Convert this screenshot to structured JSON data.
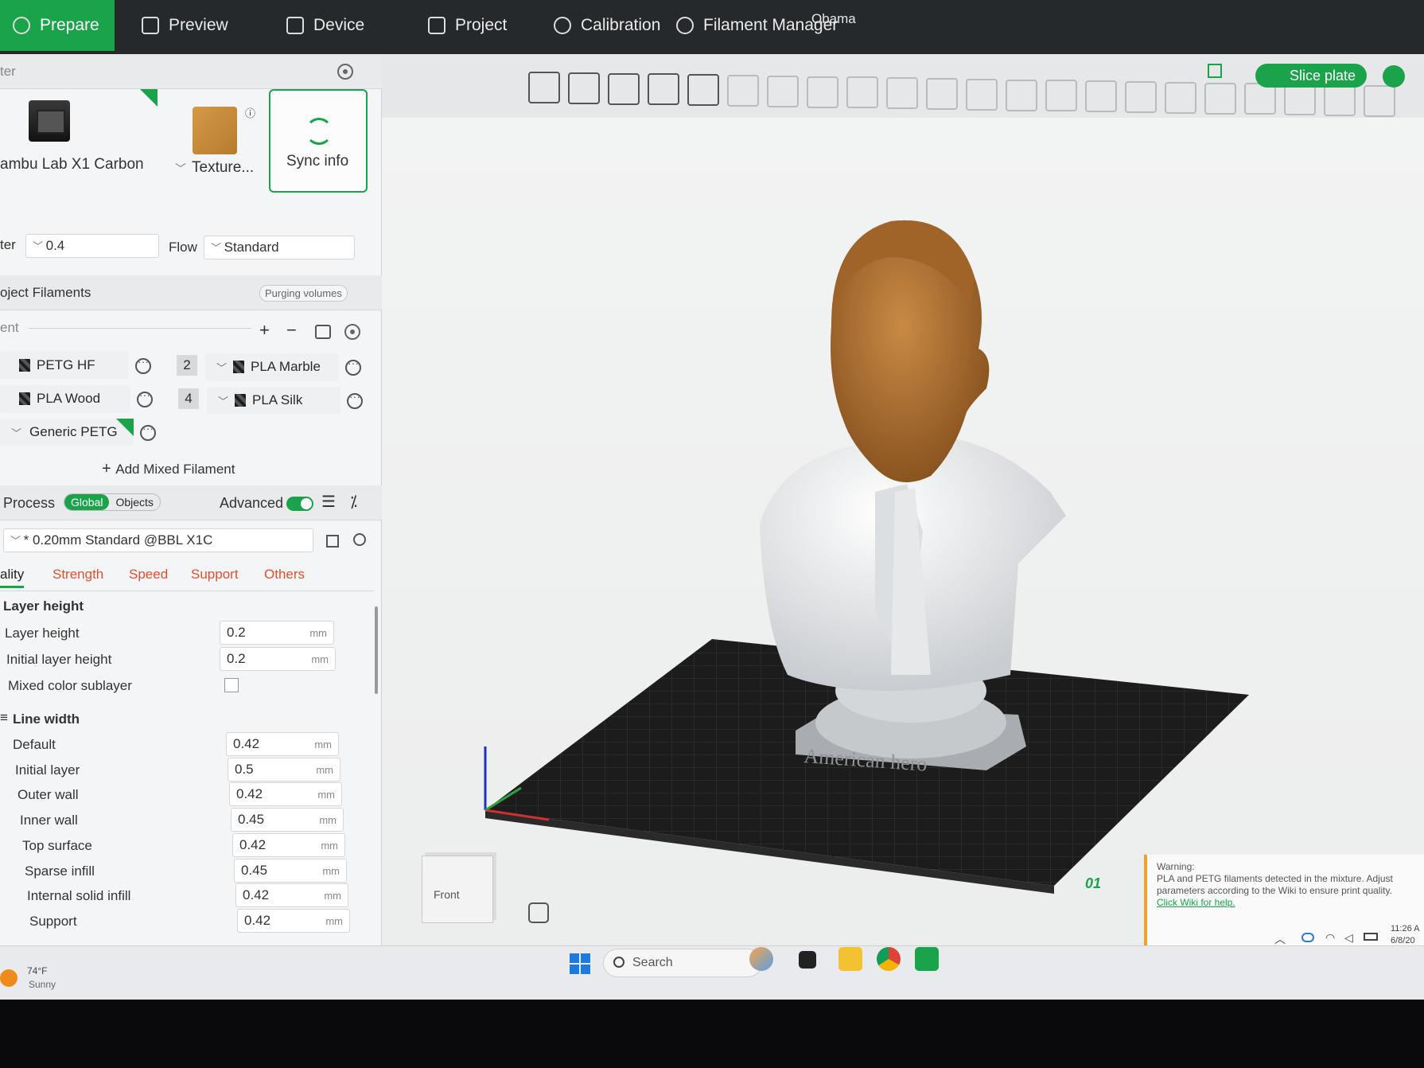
{
  "window": {
    "title": "Obama"
  },
  "tabs": [
    {
      "label": "Prepare"
    },
    {
      "label": "Preview"
    },
    {
      "label": "Device"
    },
    {
      "label": "Project"
    },
    {
      "label": "Calibration"
    },
    {
      "label": "Filament Manager"
    }
  ],
  "printer": {
    "header_label": "ter",
    "name": "ambu Lab X1 Carbon",
    "plate_label": "Texture...",
    "sync_label": "Sync info",
    "nozzle_label": "ter",
    "nozzle_value": "0.4",
    "flow_label": "Flow",
    "flow_value": "Standard"
  },
  "filaments": {
    "title": "oject Filaments",
    "purging_label": "Purging volumes",
    "sub_label": "ent",
    "items": [
      {
        "name": "PETG HF"
      },
      {
        "num": "2",
        "name": "PLA Marble"
      },
      {
        "name": "PLA Wood"
      },
      {
        "num": "4",
        "name": "PLA Silk"
      },
      {
        "name": "Generic PETG"
      }
    ],
    "add_mixed_label": "Add Mixed Filament"
  },
  "process": {
    "title": "Process",
    "global_label": "Global",
    "objects_label": "Objects",
    "advanced_label": "Advanced",
    "advanced_on": true,
    "preset": "* 0.20mm Standard @BBL X1C",
    "tabs": [
      "ality",
      "Strength",
      "Speed",
      "Support",
      "Others"
    ],
    "groups": {
      "layer_height": {
        "title": "Layer height",
        "rows": [
          {
            "label": "Layer height",
            "value": "0.2",
            "unit": "mm"
          },
          {
            "label": "Initial layer height",
            "value": "0.2",
            "unit": "mm"
          }
        ],
        "mixed_label": "Mixed color sublayer"
      },
      "line_width": {
        "title": "Line width",
        "rows": [
          {
            "label": "Default",
            "value": "0.42",
            "unit": "mm"
          },
          {
            "label": "Initial layer",
            "value": "0.5",
            "unit": "mm"
          },
          {
            "label": "Outer wall",
            "value": "0.42",
            "unit": "mm"
          },
          {
            "label": "Inner wall",
            "value": "0.45",
            "unit": "mm"
          },
          {
            "label": "Top surface",
            "value": "0.42",
            "unit": "mm"
          },
          {
            "label": "Sparse infill",
            "value": "0.45",
            "unit": "mm"
          },
          {
            "label": "Internal solid infill",
            "value": "0.42",
            "unit": "mm"
          },
          {
            "label": "Support",
            "value": "0.42",
            "unit": "mm"
          }
        ]
      }
    }
  },
  "toolbar": {
    "slice_label": "Slice plate"
  },
  "viewport": {
    "base_text": "American hero",
    "plate_number": "01",
    "view_cube_label": "Front"
  },
  "warning": {
    "title": "Warning:",
    "text": "PLA and PETG filaments detected in the mixture. Adjust parameters according to the Wiki to ensure print quality.",
    "link": "Click Wiki for help."
  },
  "taskbar": {
    "weather_temp": "74°F",
    "weather_desc": "Sunny",
    "search_placeholder": "Search",
    "time": "11:26 A",
    "date": "6/8/20"
  },
  "colors": {
    "accent": "#1aa34a",
    "warning_border": "#f0a030",
    "tab_inactive": "#e0502f"
  }
}
